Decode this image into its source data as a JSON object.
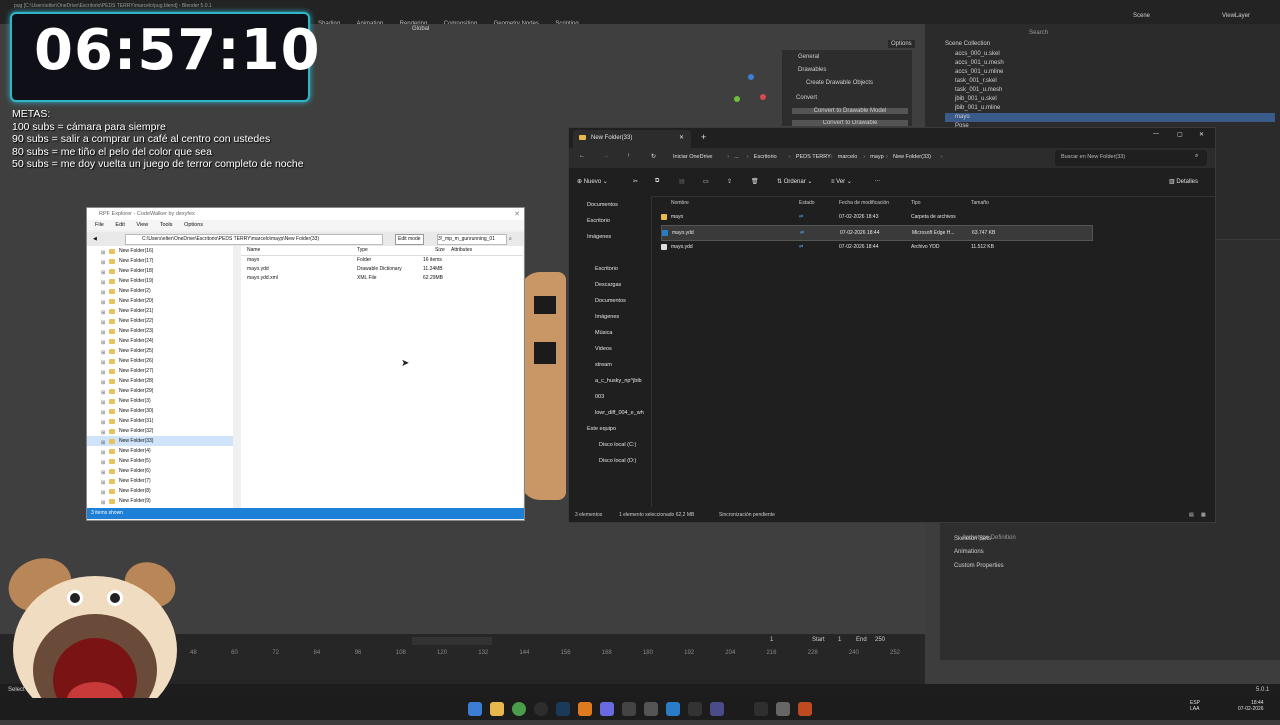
{
  "blender": {
    "window_title": "pug [C:\\Users\\elter\\OneDrive\\Escritorio\\PEDS TERRY\\marcelo\\pug.blend] - Blender 5.0.1",
    "workspaces": [
      "Shading",
      "Animation",
      "Rendering",
      "Compositing",
      "Geometry Nodes",
      "Scripting"
    ],
    "scene": "Scene",
    "view_layer": "ViewLayer",
    "transform_orientation": "Global",
    "options": "Options",
    "search_placeholder": "Search",
    "outliner_root": "Scene Collection",
    "outliner_items": [
      "accs_000_u.skel",
      "accs_001_u.mesh",
      "accs_001_u.mline",
      "task_001_r.skel",
      "task_001_u.mesh",
      "jbib_001_u.skel",
      "jbib_001_u.mline",
      "mayo",
      "Pose"
    ],
    "n_panel_items": [
      "General",
      "Drawables",
      "Create Drawable Objects",
      "Convert",
      "Convert to Drawable Model",
      "Convert to Drawable"
    ],
    "props_items": [
      "Archetype Definition",
      "Skeleton Sets",
      "Animations",
      "Custom Properties"
    ],
    "timeline_frame": "1",
    "timeline_start_label": "Start",
    "timeline_start": "1",
    "timeline_end_label": "End",
    "timeline_end": "250",
    "frame_ticks": [
      "48",
      "60",
      "72",
      "84",
      "96",
      "108",
      "120",
      "132",
      "144",
      "156",
      "168",
      "180",
      "192",
      "204",
      "216",
      "228",
      "240",
      "252"
    ],
    "version": "5.0.1",
    "status_select": "Select"
  },
  "overlay": {
    "timer": "06:57:10",
    "goals_title": "METAS:",
    "goals": [
      "100 subs = cámara para siempre",
      "90 subs = salir a comprar un café al centro con ustedes",
      "80 subs = me tiño el pelo del color que sea",
      "50 subs = me doy vuelta un juego de terror completo de noche"
    ]
  },
  "rpf": {
    "title": "RPF Explorer - CodeWalker by dexyfex",
    "menu": [
      "File",
      "Edit",
      "View",
      "Tools",
      "Options"
    ],
    "path": "C:\\Users\\elter\\OneDrive\\Escritorio\\PEDS TERRY\\marcelo\\mayp\\New Folder(33)",
    "edit_mode": "Edit mode",
    "search_value": "3!_mp_m_gunrunning_01",
    "tree": [
      "New Folder(16)",
      "New Folder(17)",
      "New Folder(18)",
      "New Folder(19)",
      "New Folder(2)",
      "New Folder(20)",
      "New Folder(21)",
      "New Folder(22)",
      "New Folder(23)",
      "New Folder(24)",
      "New Folder(25)",
      "New Folder(26)",
      "New Folder(27)",
      "New Folder(28)",
      "New Folder(29)",
      "New Folder(3)",
      "New Folder(30)",
      "New Folder(31)",
      "New Folder(32)",
      "New Folder(33)",
      "New Folder(4)",
      "New Folder(5)",
      "New Folder(6)",
      "New Folder(7)",
      "New Folder(8)",
      "New Folder(9)"
    ],
    "selected_tree": "New Folder(33)",
    "columns": [
      "Name",
      "Type",
      "Size",
      "Attributes"
    ],
    "rows": [
      {
        "name": "mayo",
        "type": "Folder",
        "size": "16 items"
      },
      {
        "name": "mayo.ydd",
        "type": "Drawable Dictionary",
        "size": "11.24MB"
      },
      {
        "name": "mayo.ydd.xml",
        "type": "XML File",
        "size": "62.29MB"
      }
    ],
    "status": "3 items shown"
  },
  "explorer": {
    "tab_title": "New Folder(33)",
    "breadcrumb": [
      "Iniciar OneDrive",
      "...",
      "Escritorio",
      "PEDS TERRY",
      "marcelo",
      "mayp",
      "New Folder(33)"
    ],
    "search_placeholder": "Buscar en New Folder(33)",
    "toolbar": {
      "new": "Nuevo",
      "sort": "Ordenar",
      "view": "Ver",
      "more": "...",
      "details": "Detalles"
    },
    "nav_top": [
      "Documentos",
      "Escritorio",
      "Imágenes"
    ],
    "nav_quick": [
      "Escritorio",
      "Descargas",
      "Documentos",
      "Imágenes",
      "Música",
      "Videos",
      "stream",
      "a_c_husky_np^jbib",
      "003",
      "lowr_diff_004_e_wh"
    ],
    "nav_pc": "Este equipo",
    "nav_drives": [
      "Disco local (C:)",
      "Disco local (D:)"
    ],
    "columns": [
      "Nombre",
      "Estado",
      "Fecha de modificación",
      "Tipo",
      "Tamaño"
    ],
    "rows": [
      {
        "name": "mayo",
        "date": "07-02-2026 18:43",
        "type": "Carpeta de archivos",
        "size": ""
      },
      {
        "name": "mayo.ydd",
        "date": "07-02-2026 18:44",
        "type": "Microsoft Edge H...",
        "size": "63.747 KB"
      },
      {
        "name": "mayo.ydd",
        "date": "07-02-2026 18:44",
        "type": "Archivo YDD",
        "size": "11.512 KB"
      }
    ],
    "status": [
      "3 elementos",
      "1 elemento seleccionado  62,2 MB",
      "Sincronización pendiente"
    ]
  },
  "taskbar": {
    "lang": "ESP",
    "lang_sub": "LAA",
    "time": "18:44",
    "date": "07-02-2026"
  }
}
